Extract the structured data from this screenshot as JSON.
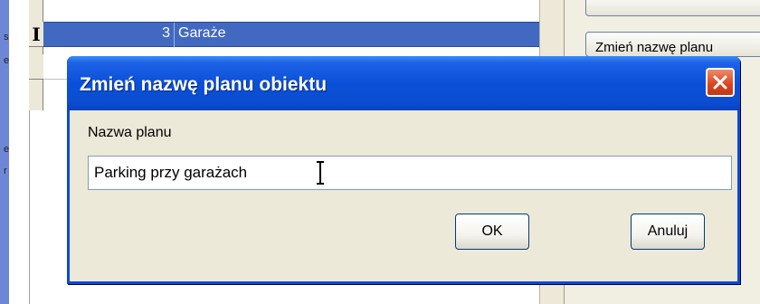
{
  "grid": {
    "selected_row": {
      "number": "3",
      "name": "Garaże"
    },
    "row_indicator_glyph": "I"
  },
  "right_panel": {
    "top_button_label": "",
    "rename_button_label": "Zmień nazwę planu"
  },
  "dialog": {
    "title": "Zmień nazwę planu obiektu",
    "field_label": "Nazwa planu",
    "input_value": "Parking przy garażach",
    "ok_label": "OK",
    "cancel_label": "Anuluj",
    "colors": {
      "titlebar": "#0a50d8",
      "close_button": "#d9421c",
      "selection": "#4169c1"
    },
    "icons": {
      "close": "close-icon",
      "cursor": "text-cursor-icon"
    }
  }
}
